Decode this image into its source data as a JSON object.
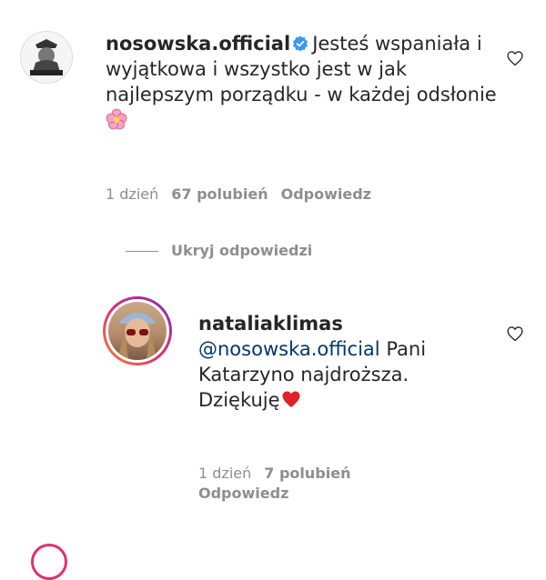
{
  "comment": {
    "username": "nosowska.official",
    "text": "Jesteś wspaniała i wyjątkowa i wszystko jest w jak najlepszym porządku - w każdej odsłonie",
    "emoji": "pink-flower",
    "time": "1 dzień",
    "likes": "67 polubień",
    "reply_label": "Odpowiedz"
  },
  "replies_toggle": "Ukryj odpowiedzi",
  "reply": {
    "username": "nataliaklimas",
    "mention": "@nosowska.official",
    "text": " Pani Katarzyno najdroższa. Dziękuję",
    "emoji": "red-heart",
    "time": "1 dzień",
    "likes": "7 polubień",
    "reply_label": "Odpowiedz"
  },
  "colors": {
    "verified": "#3897f0",
    "mention": "#00376b",
    "meta": "#8e8e8e"
  }
}
